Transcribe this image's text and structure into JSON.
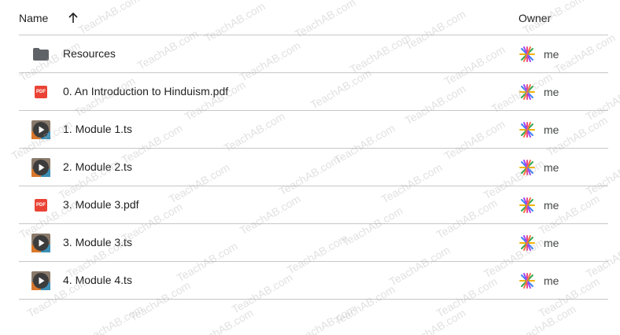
{
  "header": {
    "name_label": "Name",
    "sort_icon": "arrow-up-icon",
    "owner_label": "Owner"
  },
  "files": [
    {
      "name": "Resources",
      "type": "folder",
      "icon": "folder-icon",
      "owner": "me"
    },
    {
      "name": "0. An Introduction to Hinduism.pdf",
      "type": "pdf",
      "icon": "pdf-icon",
      "owner": "me"
    },
    {
      "name": "1. Module 1.ts",
      "type": "video",
      "icon": "video-icon",
      "owner": "me"
    },
    {
      "name": "2. Module 2.ts",
      "type": "video",
      "icon": "video-icon",
      "owner": "me"
    },
    {
      "name": "3. Module 3.pdf",
      "type": "pdf",
      "icon": "pdf-icon",
      "owner": "me"
    },
    {
      "name": "3. Module 3.ts",
      "type": "video",
      "icon": "video-icon",
      "owner": "me"
    },
    {
      "name": "4. Module 4.ts",
      "type": "video",
      "icon": "video-icon",
      "owner": "me"
    }
  ],
  "pdf_badge_text": "PDF",
  "watermark_text": "TeachAB.com",
  "colors": {
    "pdf_red": "#ea4335",
    "folder_gray": "#5f6368",
    "divider": "#c7c7c7"
  }
}
